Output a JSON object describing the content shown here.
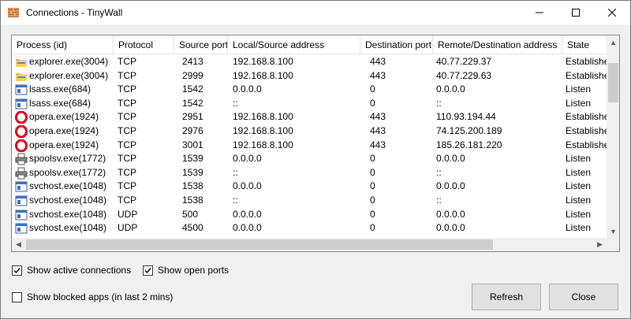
{
  "window": {
    "title": "Connections - TinyWall"
  },
  "columns": [
    "Process (id)",
    "Protocol",
    "Source port",
    "Local/Source address",
    "Destination port",
    "Remote/Destination address",
    "State"
  ],
  "rows": [
    {
      "icon": "explorer-icon",
      "process": "explorer.exe(3004)",
      "protocol": "TCP",
      "source_port": "2413",
      "local_address": "192.168.8.100",
      "dest_port": "443",
      "remote_address": "40.77.229.37",
      "state": "Established"
    },
    {
      "icon": "explorer-icon",
      "process": "explorer.exe(3004)",
      "protocol": "TCP",
      "source_port": "2999",
      "local_address": "192.168.8.100",
      "dest_port": "443",
      "remote_address": "40.77.229.63",
      "state": "Established"
    },
    {
      "icon": "app-window-icon",
      "process": "lsass.exe(684)",
      "protocol": "TCP",
      "source_port": "1542",
      "local_address": "0.0.0.0",
      "dest_port": "0",
      "remote_address": "0.0.0.0",
      "state": "Listen"
    },
    {
      "icon": "app-window-icon",
      "process": "lsass.exe(684)",
      "protocol": "TCP",
      "source_port": "1542",
      "local_address": "::",
      "dest_port": "0",
      "remote_address": "::",
      "state": "Listen"
    },
    {
      "icon": "opera-icon",
      "process": "opera.exe(1924)",
      "protocol": "TCP",
      "source_port": "2951",
      "local_address": "192.168.8.100",
      "dest_port": "443",
      "remote_address": "110.93.194.44",
      "state": "Established"
    },
    {
      "icon": "opera-icon",
      "process": "opera.exe(1924)",
      "protocol": "TCP",
      "source_port": "2976",
      "local_address": "192.168.8.100",
      "dest_port": "443",
      "remote_address": "74.125.200.189",
      "state": "Established"
    },
    {
      "icon": "opera-icon",
      "process": "opera.exe(1924)",
      "protocol": "TCP",
      "source_port": "3001",
      "local_address": "192.168.8.100",
      "dest_port": "443",
      "remote_address": "185.26.181.220",
      "state": "Established"
    },
    {
      "icon": "printer-icon",
      "process": "spoolsv.exe(1772)",
      "protocol": "TCP",
      "source_port": "1539",
      "local_address": "0.0.0.0",
      "dest_port": "0",
      "remote_address": "0.0.0.0",
      "state": "Listen"
    },
    {
      "icon": "printer-icon",
      "process": "spoolsv.exe(1772)",
      "protocol": "TCP",
      "source_port": "1539",
      "local_address": "::",
      "dest_port": "0",
      "remote_address": "::",
      "state": "Listen"
    },
    {
      "icon": "app-window-icon",
      "process": "svchost.exe(1048)",
      "protocol": "TCP",
      "source_port": "1538",
      "local_address": "0.0.0.0",
      "dest_port": "0",
      "remote_address": "0.0.0.0",
      "state": "Listen"
    },
    {
      "icon": "app-window-icon",
      "process": "svchost.exe(1048)",
      "protocol": "TCP",
      "source_port": "1538",
      "local_address": "::",
      "dest_port": "0",
      "remote_address": "::",
      "state": "Listen"
    },
    {
      "icon": "app-window-icon",
      "process": "svchost.exe(1048)",
      "protocol": "UDP",
      "source_port": "500",
      "local_address": "0.0.0.0",
      "dest_port": "0",
      "remote_address": "0.0.0.0",
      "state": "Listen"
    },
    {
      "icon": "app-window-icon",
      "process": "svchost.exe(1048)",
      "protocol": "UDP",
      "source_port": "4500",
      "local_address": "0.0.0.0",
      "dest_port": "0",
      "remote_address": "0.0.0.0",
      "state": "Listen"
    }
  ],
  "options": {
    "show_active": {
      "label": "Show active connections",
      "checked": true
    },
    "show_open_ports": {
      "label": "Show open ports",
      "checked": true
    },
    "show_blocked": {
      "label": "Show blocked apps (in last 2 mins)",
      "checked": false
    }
  },
  "buttons": {
    "refresh": "Refresh",
    "close": "Close"
  },
  "colors": {
    "accent": "#0078d7",
    "opera": "#e0001b",
    "explorer": "#f4c542"
  }
}
